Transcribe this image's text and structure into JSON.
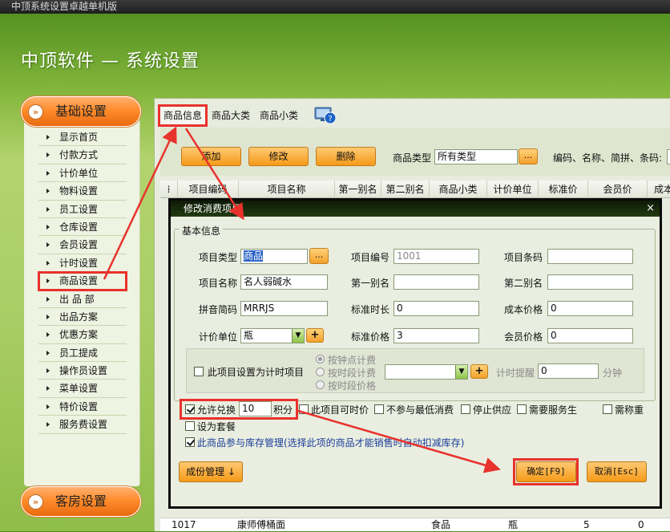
{
  "window": {
    "title": "中顶系统设置卓越单机版"
  },
  "header": {
    "title": "中顶软件 — 系统设置"
  },
  "sidebar": {
    "section_basic": "基础设置",
    "section_room": "客房设置",
    "items": [
      {
        "label": "显示首页"
      },
      {
        "label": "付款方式"
      },
      {
        "label": "计价单位"
      },
      {
        "label": "物料设置"
      },
      {
        "label": "员工设置"
      },
      {
        "label": "仓库设置"
      },
      {
        "label": "会员设置"
      },
      {
        "label": "计时设置"
      },
      {
        "label": "商品设置"
      },
      {
        "label": "出 品 部"
      },
      {
        "label": "出品方案"
      },
      {
        "label": "优惠方案"
      },
      {
        "label": "员工提成"
      },
      {
        "label": "操作员设置"
      },
      {
        "label": "菜单设置"
      },
      {
        "label": "特价设置"
      },
      {
        "label": "服务费设置"
      }
    ],
    "active_index": 8
  },
  "tabs": [
    {
      "label": "商品信息"
    },
    {
      "label": "商品大类"
    },
    {
      "label": "商品小类"
    }
  ],
  "toolbar": {
    "add": "添加",
    "edit": "修改",
    "delete": "删除",
    "type_label": "商品类型",
    "type_value": "所有类型",
    "dots": "...",
    "search_label": "编码、名称、简拼、条码:"
  },
  "grid": {
    "headers": [
      "项目编码",
      "项目名称",
      "第一别名",
      "第二别名",
      "商品小类",
      "计价单位",
      "标准价",
      "会员价",
      "成本"
    ],
    "row_bottom": {
      "code": "1017",
      "name": "康师傅桶面",
      "sub": "食品",
      "unit": "瓶",
      "price": "5",
      "member": "0"
    }
  },
  "dialog": {
    "title": "修改消费项目",
    "close": "×",
    "group": "基本信息",
    "fields": {
      "item_type_label": "项目类型",
      "item_type_value": "商品",
      "item_code_label": "项目编号",
      "item_code_value": "1001",
      "barcode_label": "项目条码",
      "barcode_value": "",
      "name_label": "项目名称",
      "name_value": "名人弱碱水",
      "alias1_label": "第一别名",
      "alias1_value": "",
      "alias2_label": "第二别名",
      "alias2_value": "",
      "pinyin_label": "拼音简码",
      "pinyin_value": "MRRJS",
      "std_duration_label": "标准时长",
      "std_duration_value": "0",
      "cost_label": "成本价格",
      "cost_value": "0",
      "unit_label": "计价单位",
      "unit_value": "瓶",
      "std_price_label": "标准价格",
      "std_price_value": "3",
      "member_price_label": "会员价格",
      "member_price_value": "0",
      "plus": "+"
    },
    "timing": {
      "checkbox_label": "此项目设置为计时项目",
      "radio1": "按钟点计费",
      "radio2": "按时段计费",
      "radio3": "按时段价格",
      "reminder_label": "计时提醒",
      "reminder_value": "0",
      "unit": "分钟"
    },
    "options": {
      "allow_exchange": "允许兑换",
      "points_value": "10",
      "points_unit": "积分",
      "time_price": "此项目可时价",
      "no_min": "不参与最低消费",
      "stop_supply": "停止供应",
      "need_service": "需要服务生",
      "need_weigh": "需称重",
      "set_meal": "设为套餐",
      "inventory": "此商品参与库存管理(选择此项的商品才能销售时自动扣减库存)"
    },
    "buttons": {
      "components": "成份管理 ↓",
      "ok": "确定[F9]",
      "cancel": "取消[Esc]"
    }
  }
}
